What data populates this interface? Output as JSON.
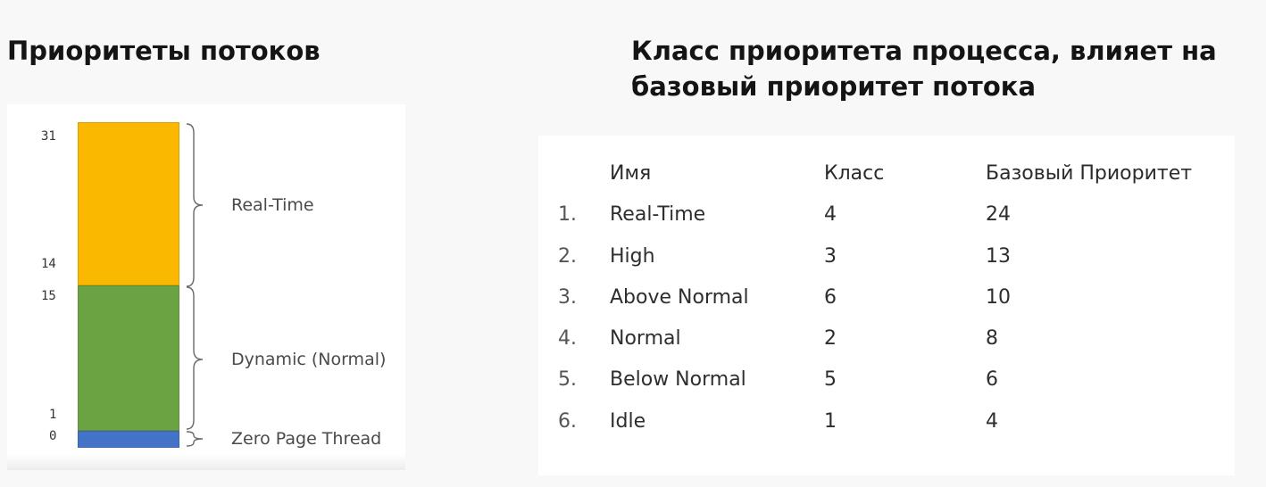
{
  "left_title": "Приоритеты потоков",
  "right_title": "Класс приоритета процесса, влияет на базовый приоритет потока",
  "diagram": {
    "ticks": [
      "31",
      "14",
      "15",
      "1",
      "0"
    ],
    "bands": [
      {
        "label": "Real-Time",
        "range_min": 16,
        "range_max": 31,
        "color": "#fbb800"
      },
      {
        "label": "Dynamic (Normal)",
        "range_min": 1,
        "range_max": 15,
        "color": "#6ba342"
      },
      {
        "label": "Zero Page Thread",
        "range_min": 0,
        "range_max": 0,
        "color": "#4373c6"
      }
    ]
  },
  "table": {
    "headers": [
      "Имя",
      "Класс",
      "Базовый Приоритет"
    ],
    "rows": [
      {
        "num": "1.",
        "name": "Real-Time",
        "class": "4",
        "base": "24"
      },
      {
        "num": "2.",
        "name": "High",
        "class": "3",
        "base": "13"
      },
      {
        "num": "3.",
        "name": "Above Normal",
        "class": "6",
        "base": "10"
      },
      {
        "num": "4.",
        "name": "Normal",
        "class": "2",
        "base": "8"
      },
      {
        "num": "5.",
        "name": "Below Normal",
        "class": "5",
        "base": "6"
      },
      {
        "num": "6.",
        "name": "Idle",
        "class": "1",
        "base": "4"
      }
    ]
  }
}
